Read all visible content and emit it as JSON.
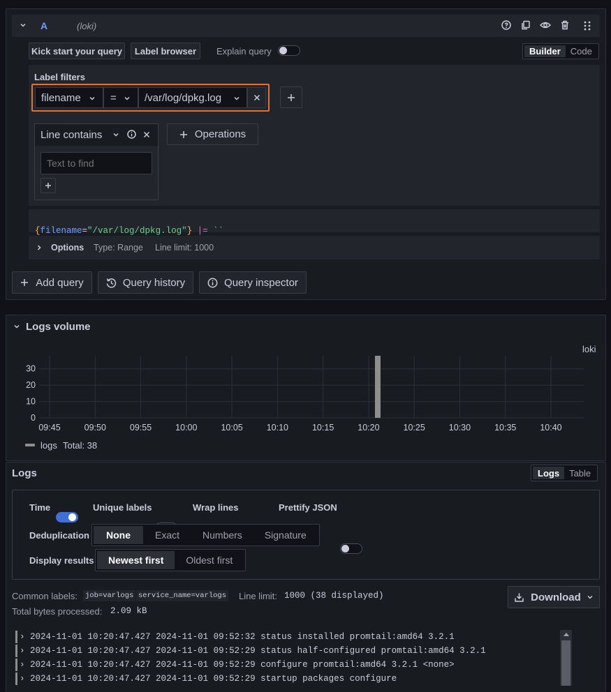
{
  "query": {
    "letter": "A",
    "datasource": "(loki)",
    "kick_start": "Kick start your query",
    "label_browser": "Label browser",
    "explain_query": "Explain query",
    "modes": [
      "Builder",
      "Code"
    ],
    "label_filters_title": "Label filters",
    "filter": {
      "label": "filename",
      "op": "=",
      "value": "/var/log/dpkg.log"
    },
    "line_contains": "Line contains",
    "text_placeholder": "Text to find",
    "operations": "Operations",
    "preview": {
      "open": "{",
      "key": "filename",
      "eq": "=",
      "val": "\"/var/log/dpkg.log\"",
      "close": "}",
      "pipe": "|=",
      "str": "``"
    },
    "options_label": "Options",
    "options_type": "Type: Range",
    "options_limit": "Line limit: 1000"
  },
  "actions": {
    "add_query": "Add query",
    "query_history": "Query history",
    "query_inspector": "Query inspector"
  },
  "volume": {
    "title": "Logs volume",
    "legend_source": "loki",
    "legend_series": "logs",
    "legend_total": "Total: 38"
  },
  "chart_data": {
    "type": "bar",
    "x": [
      "09:45",
      "09:50",
      "09:55",
      "10:00",
      "10:05",
      "10:10",
      "10:15",
      "10:20",
      "10:25",
      "10:30",
      "10:35",
      "10:40"
    ],
    "yticks": [
      0,
      10,
      20,
      30
    ],
    "ylim": [
      0,
      38
    ],
    "series": [
      {
        "name": "logs",
        "values": [
          {
            "x": "10:21",
            "y": 38
          }
        ]
      }
    ],
    "colors": {
      "bar": "#8e8e8e"
    }
  },
  "logs": {
    "title": "Logs",
    "view_modes": [
      "Logs",
      "Table"
    ],
    "time_label": "Time",
    "unique_labels": "Unique labels",
    "wrap_lines": "Wrap lines",
    "prettify_json": "Prettify JSON",
    "dedup_label": "Deduplication",
    "dedup_options": [
      "None",
      "Exact",
      "Numbers",
      "Signature"
    ],
    "display_label": "Display results",
    "display_options": [
      "Newest first",
      "Oldest first"
    ],
    "common_labels_label": "Common labels:",
    "common_labels": [
      "job=varlogs",
      "service_name=varlogs"
    ],
    "line_limit_label": "Line limit:",
    "line_limit_value": "1000 (38 displayed)",
    "bytes_label": "Total bytes processed:",
    "bytes_value": "2.09 kB",
    "download": "Download",
    "lines": [
      "2024-11-01 10:20:47.427 2024-11-01 09:52:32 status installed promtail:amd64 3.2.1",
      "2024-11-01 10:20:47.427 2024-11-01 09:52:29 status half-configured promtail:amd64 3.2.1",
      "2024-11-01 10:20:47.427 2024-11-01 09:52:29 configure promtail:amd64 3.2.1 <none>",
      "2024-11-01 10:20:47.427 2024-11-01 09:52:29 startup packages configure"
    ]
  }
}
